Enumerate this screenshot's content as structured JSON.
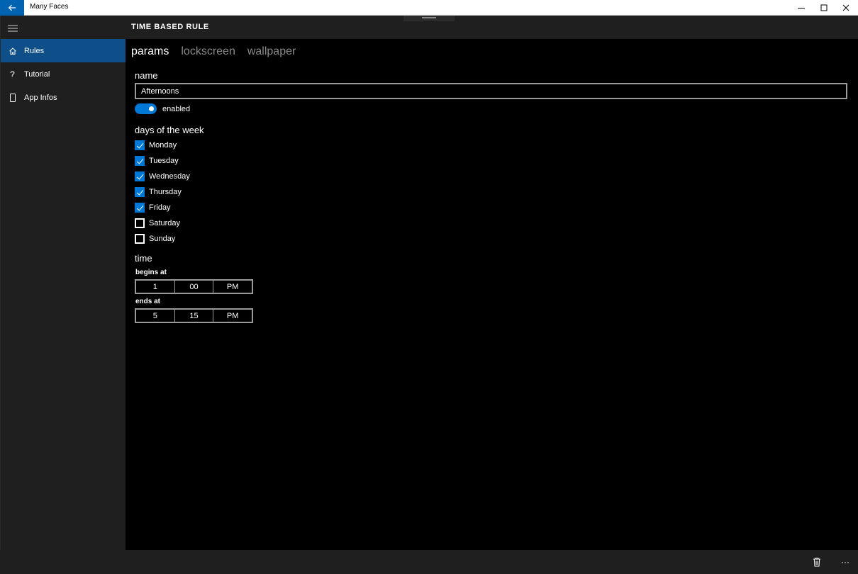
{
  "window": {
    "title": "Many Faces"
  },
  "sidebar": {
    "items": [
      {
        "label": "Rules",
        "icon": "home-icon",
        "active": true
      },
      {
        "label": "Tutorial",
        "icon": "question-icon",
        "active": false
      },
      {
        "label": "App Infos",
        "icon": "phone-icon",
        "active": false
      }
    ]
  },
  "header": {
    "title": "TIME BASED RULE"
  },
  "tabs": [
    {
      "label": "params",
      "active": true
    },
    {
      "label": "lockscreen",
      "active": false
    },
    {
      "label": "wallpaper",
      "active": false
    }
  ],
  "form": {
    "name_title": "name",
    "name_value": "Afternoons",
    "enabled_label": "enabled",
    "enabled": true,
    "days_title": "days of the week",
    "days": [
      {
        "label": "Monday",
        "checked": true
      },
      {
        "label": "Tuesday",
        "checked": true
      },
      {
        "label": "Wednesday",
        "checked": true
      },
      {
        "label": "Thursday",
        "checked": true
      },
      {
        "label": "Friday",
        "checked": true
      },
      {
        "label": "Saturday",
        "checked": false
      },
      {
        "label": "Sunday",
        "checked": false
      }
    ],
    "time_title": "time",
    "begins_label": "begins at",
    "begins": {
      "hour": "1",
      "minute": "00",
      "period": "PM"
    },
    "ends_label": "ends at",
    "ends": {
      "hour": "5",
      "minute": "15",
      "period": "PM"
    }
  },
  "bottom_bar": {
    "delete_icon": "trash-icon",
    "more_icon": "more-icon",
    "more_glyph": "···"
  },
  "colors": {
    "accent": "#0078d7",
    "nav_active": "#0f4f89",
    "back_button": "#0063b1"
  }
}
